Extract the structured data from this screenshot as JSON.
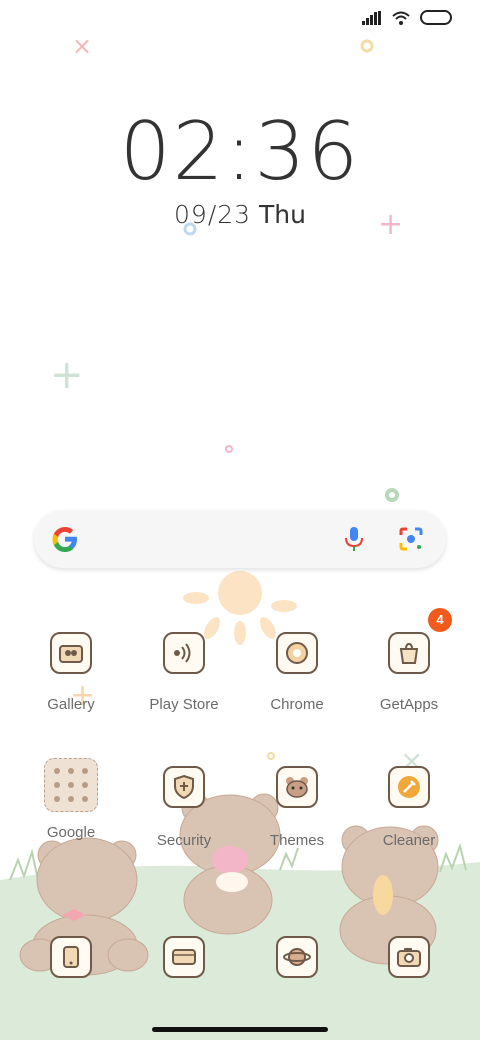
{
  "status_bar": {
    "signal": "signal-icon",
    "wifi": "wifi-icon",
    "battery": "battery-icon"
  },
  "clock": {
    "time": "02:36",
    "date": "09/23",
    "weekday": "Thu"
  },
  "search": {
    "logo": "google-g-icon",
    "mic": "mic-icon",
    "lens": "lens-icon"
  },
  "apps_row1": [
    {
      "label": "Gallery"
    },
    {
      "label": "Play Store"
    },
    {
      "label": "Chrome"
    },
    {
      "label": "GetApps",
      "badge": "4"
    }
  ],
  "apps_row2": [
    {
      "label": "Google"
    },
    {
      "label": "Security"
    },
    {
      "label": "Themes"
    },
    {
      "label": "Cleaner"
    }
  ],
  "dock": [
    {
      "icon": "phone-icon"
    },
    {
      "icon": "messages-icon"
    },
    {
      "icon": "browser-icon"
    },
    {
      "icon": "camera-icon"
    }
  ],
  "colors": {
    "accent": "#f05a1c",
    "icon_border": "#6f5a4a",
    "grass": "#dcebd9",
    "bear": "#d9c3b3"
  }
}
